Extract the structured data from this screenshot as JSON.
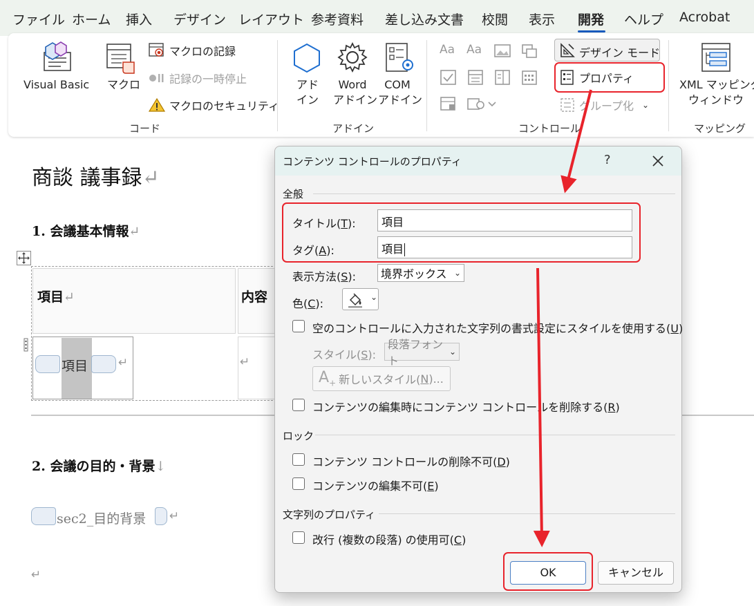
{
  "ribbon_tabs": [
    {
      "label": "ファイル"
    },
    {
      "label": "ホーム"
    },
    {
      "label": "挿入"
    },
    {
      "label": "デザイン"
    },
    {
      "label": "レイアウト"
    },
    {
      "label": "参考資料"
    },
    {
      "label": "差し込み文書"
    },
    {
      "label": "校閲"
    },
    {
      "label": "表示"
    },
    {
      "label": "開発",
      "active": true
    },
    {
      "label": "ヘルプ"
    },
    {
      "label": "Acrobat"
    }
  ],
  "ribbon": {
    "code_group": {
      "label": "コード",
      "visual_basic": "Visual Basic",
      "macro": "マクロ",
      "record_macro": "マクロの記録",
      "pause_recording": "記録の一時停止",
      "macro_security": "マクロのセキュリティ"
    },
    "addin_group": {
      "label": "アドイン",
      "addin_line1": "アド",
      "addin_line2": "イン",
      "word_line1": "Word",
      "word_line2": "アドイン",
      "com_line1": "COM",
      "com_line2": "アドイン"
    },
    "controls_group": {
      "label": "コントロール",
      "design_mode": "デザイン モード",
      "properties": "プロパティ",
      "group": "グループ化"
    },
    "mapping_group": {
      "label": "マッピング",
      "xml_line1": "XML マッピング",
      "xml_line2": "ウィンドウ"
    }
  },
  "document": {
    "title": "商談  議事録",
    "heading1": "1.  会議基本情報",
    "table_header_1": "項目",
    "table_header_2": "内容",
    "cc_text": "項目",
    "heading2": "2.  会議の目的・背景",
    "placeholder": "sec2_目的背景",
    "para_mark": "↵",
    "line_mark": "↓"
  },
  "dialog": {
    "title": "コンテンツ コントロールのプロパティ",
    "help": "?",
    "section_general": "全般",
    "title_label_pre": "タイトル(",
    "title_label_key": "T",
    "title_label_post": "):",
    "title_value": "項目",
    "tag_label_pre": "タグ(",
    "tag_label_key": "A",
    "tag_label_post": "):",
    "tag_value": "項目",
    "display_label_pre": "表示方法(",
    "display_label_key": "S",
    "display_label_post": "):",
    "display_value": "境界ボックス",
    "color_label_pre": "色(",
    "color_label_key": "C",
    "color_label_post": "):",
    "use_style_pre": "空のコントロールに入力された文字列の書式設定にスタイルを使用する(",
    "use_style_key": "U",
    "use_style_post": ")",
    "style_label_pre": "スタイル(",
    "style_label_key": "S",
    "style_label_post": "):",
    "style_value": "段落フォント",
    "new_style_pre": "新しいスタイル(",
    "new_style_key": "N",
    "new_style_post": ")...",
    "remove_when_edited_pre": "コンテンツの編集時にコンテンツ コントロールを削除する(",
    "remove_when_edited_key": "R",
    "remove_when_edited_post": ")",
    "section_lock": "ロック",
    "lock_delete_pre": "コンテンツ コントロールの削除不可(",
    "lock_delete_key": "D",
    "lock_delete_post": ")",
    "lock_edit_pre": "コンテンツの編集不可(",
    "lock_edit_key": "E",
    "lock_edit_post": ")",
    "section_text": "文字列のプロパティ",
    "multi_para_pre": "改行 (複数の段落) の使用可(",
    "multi_para_key": "C",
    "multi_para_post": ")",
    "ok": "OK",
    "cancel": "キャンセル"
  },
  "colors": {
    "highlight_red": "#e8232b",
    "tab_underline": "#185abd",
    "dialog_titlebar": "#e6f2f1"
  }
}
